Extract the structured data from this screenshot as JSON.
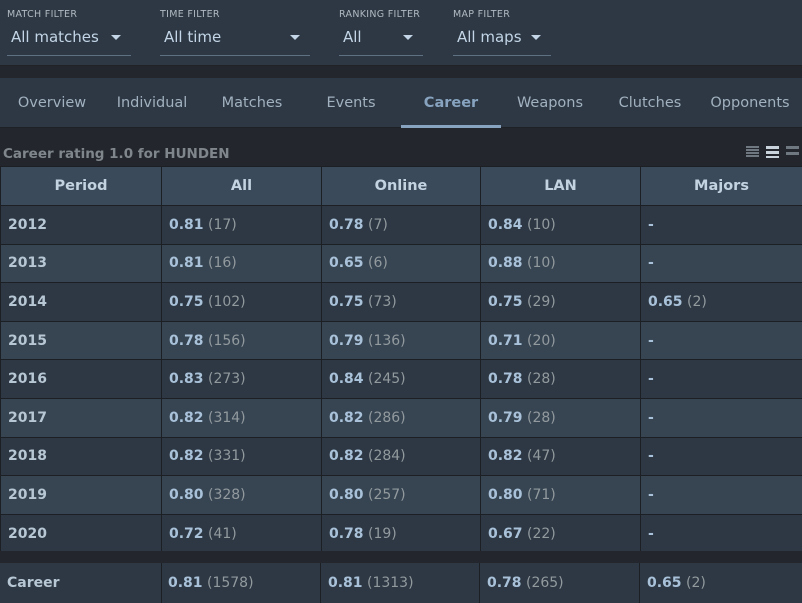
{
  "filters": [
    {
      "label": "MATCH FILTER",
      "value": "All matches"
    },
    {
      "label": "TIME FILTER",
      "value": "All time"
    },
    {
      "label": "RANKING FILTER",
      "value": "All"
    },
    {
      "label": "MAP FILTER",
      "value": "All maps"
    }
  ],
  "tabs": [
    {
      "label": "Overview"
    },
    {
      "label": "Individual"
    },
    {
      "label": "Matches"
    },
    {
      "label": "Events"
    },
    {
      "label": "Career",
      "active": true
    },
    {
      "label": "Weapons"
    },
    {
      "label": "Clutches"
    },
    {
      "label": "Opponents"
    }
  ],
  "caption": "Career rating 1.0 for HUNDEN",
  "view_icons": [
    "list-compact-icon",
    "list-medium-icon",
    "list-large-icon"
  ],
  "table": {
    "headers": [
      "Period",
      "All",
      "Online",
      "LAN",
      "Majors"
    ],
    "rows": [
      {
        "period": "2012",
        "all": [
          "0.81",
          "(17)"
        ],
        "online": [
          "0.78",
          "(7)"
        ],
        "lan": [
          "0.84",
          "(10)"
        ],
        "majors": [
          "-",
          ""
        ]
      },
      {
        "period": "2013",
        "all": [
          "0.81",
          "(16)"
        ],
        "online": [
          "0.65",
          "(6)"
        ],
        "lan": [
          "0.88",
          "(10)"
        ],
        "majors": [
          "-",
          ""
        ]
      },
      {
        "period": "2014",
        "all": [
          "0.75",
          "(102)"
        ],
        "online": [
          "0.75",
          "(73)"
        ],
        "lan": [
          "0.75",
          "(29)"
        ],
        "majors": [
          "0.65",
          "(2)"
        ]
      },
      {
        "period": "2015",
        "all": [
          "0.78",
          "(156)"
        ],
        "online": [
          "0.79",
          "(136)"
        ],
        "lan": [
          "0.71",
          "(20)"
        ],
        "majors": [
          "-",
          ""
        ]
      },
      {
        "period": "2016",
        "all": [
          "0.83",
          "(273)"
        ],
        "online": [
          "0.84",
          "(245)"
        ],
        "lan": [
          "0.78",
          "(28)"
        ],
        "majors": [
          "-",
          ""
        ]
      },
      {
        "period": "2017",
        "all": [
          "0.82",
          "(314)"
        ],
        "online": [
          "0.82",
          "(286)"
        ],
        "lan": [
          "0.79",
          "(28)"
        ],
        "majors": [
          "-",
          ""
        ]
      },
      {
        "period": "2018",
        "all": [
          "0.82",
          "(331)"
        ],
        "online": [
          "0.82",
          "(284)"
        ],
        "lan": [
          "0.82",
          "(47)"
        ],
        "majors": [
          "-",
          ""
        ]
      },
      {
        "period": "2019",
        "all": [
          "0.80",
          "(328)"
        ],
        "online": [
          "0.80",
          "(257)"
        ],
        "lan": [
          "0.80",
          "(71)"
        ],
        "majors": [
          "-",
          ""
        ]
      },
      {
        "period": "2020",
        "all": [
          "0.72",
          "(41)"
        ],
        "online": [
          "0.78",
          "(19)"
        ],
        "lan": [
          "0.67",
          "(22)"
        ],
        "majors": [
          "-",
          ""
        ]
      }
    ],
    "career": {
      "period": "Career",
      "all": [
        "0.81",
        "(1578)"
      ],
      "online": [
        "0.81",
        "(1313)"
      ],
      "lan": [
        "0.78",
        "(265)"
      ],
      "majors": [
        "0.65",
        "(2)"
      ]
    }
  },
  "colors": {
    "accent": "#87a3bf",
    "header_bg": "#3a4a5b",
    "row_dark": "#2d3844",
    "row_light": "#374553"
  }
}
